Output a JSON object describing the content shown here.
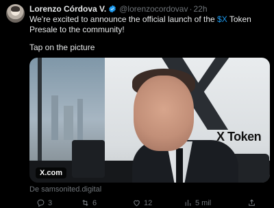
{
  "tweet": {
    "author_name": "Lorenzo Córdova V.",
    "handle": "@lorenzocordovav",
    "separator": "·",
    "time": "22h",
    "text_before": "We're excited to announce the official launch of the ",
    "cashtag": "$X",
    "text_after": " Token Presale to the community!",
    "tap_text": "Tap on the picture",
    "media_label": "X.com",
    "media_sign_text": "X Token",
    "source": "De samsonited.digital",
    "actions": {
      "replies": "3",
      "retweets": "6",
      "likes": "12",
      "views": "5 mil"
    }
  },
  "colors": {
    "background": "#000000",
    "text": "#e7e9ea",
    "muted": "#71767b",
    "accent": "#1d9bf0"
  },
  "icons": [
    "verified-badge-icon",
    "reply-icon",
    "retweet-icon",
    "like-icon",
    "views-icon",
    "share-icon"
  ]
}
